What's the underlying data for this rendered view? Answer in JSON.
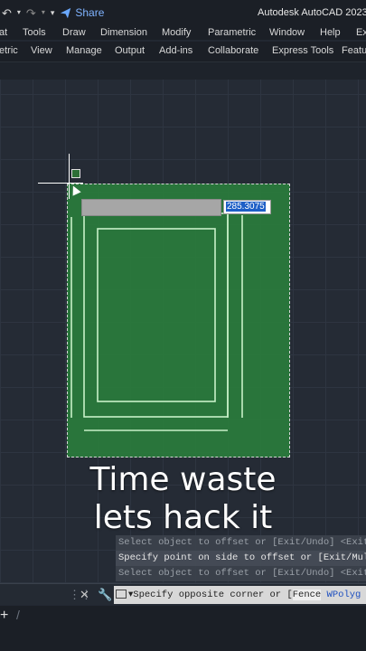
{
  "titlebar": {
    "share_label": "Share",
    "app_title": "Autodesk AutoCAD 2023"
  },
  "menubar": {
    "items": [
      "at",
      "Tools",
      "Draw",
      "Dimension",
      "Modify",
      "Parametric",
      "Window",
      "Help",
      "Ex"
    ]
  },
  "tabbar": {
    "items": [
      "etric",
      "View",
      "Manage",
      "Output",
      "Add-ins",
      "Collaborate",
      "Express Tools",
      "Featu"
    ]
  },
  "dimension_input": {
    "value": "285.3075"
  },
  "overlay": {
    "line1": "Time waste",
    "line2": "lets hack it"
  },
  "command_history": [
    "Select object to offset or [Exit/Undo] <Exit",
    "Specify point on side to offset or [Exit/Mul",
    "Select object to offset or [Exit/Undo] <Exit"
  ],
  "command_line": {
    "prompt": "Specify opposite corner or [",
    "option1": "Fence",
    "option2": "WPolyg"
  },
  "colors": {
    "selection_fill": "#2a7a3c",
    "line_color": "#c8f0c8",
    "accent_blue": "#1e5fc6"
  }
}
